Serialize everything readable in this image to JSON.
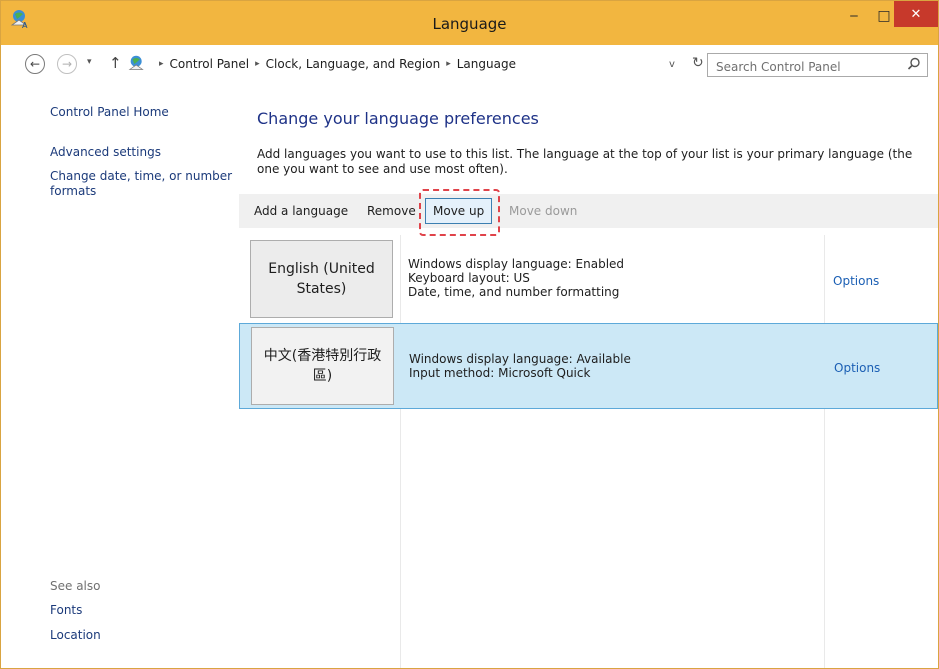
{
  "window": {
    "title": "Language",
    "minimize_glyph": "‒",
    "maximize_glyph": "□",
    "close_glyph": "✕",
    "accent_color": "#f2b640"
  },
  "addressbar": {
    "back_glyph": "←",
    "forward_glyph": "→",
    "recent_glyph": "▾",
    "up_glyph": "↑",
    "breadcrumbs": [
      "Control Panel",
      "Clock, Language, and Region",
      "Language"
    ],
    "separator_glyph": "▸",
    "dropdown_glyph": "v",
    "refresh_glyph": "↻",
    "search_placeholder": "Search Control Panel"
  },
  "leftnav": {
    "home": "Control Panel Home",
    "advanced": "Advanced settings",
    "date_formats": "Change date, time, or number formats",
    "see_also": "See also",
    "fonts": "Fonts",
    "location": "Location"
  },
  "main": {
    "title": "Change your language preferences",
    "description": "Add languages you want to use to this list. The language at the top of your list is your primary language (the one you want to see and use most often)."
  },
  "toolbar": {
    "add": "Add a language",
    "remove": "Remove",
    "move_up": "Move up",
    "move_down": "Move down"
  },
  "languages": [
    {
      "name": "English (United States)",
      "details": [
        "Windows display language: Enabled",
        "Keyboard layout: US",
        "Date, time, and number formatting"
      ],
      "options": "Options"
    },
    {
      "name": "中文(香港特別行政區)",
      "details": [
        "Windows display language: Available",
        "Input method: Microsoft Quick"
      ],
      "options": "Options"
    }
  ],
  "icons": {
    "app": "control-panel-globe-icon",
    "search": "search-icon"
  }
}
